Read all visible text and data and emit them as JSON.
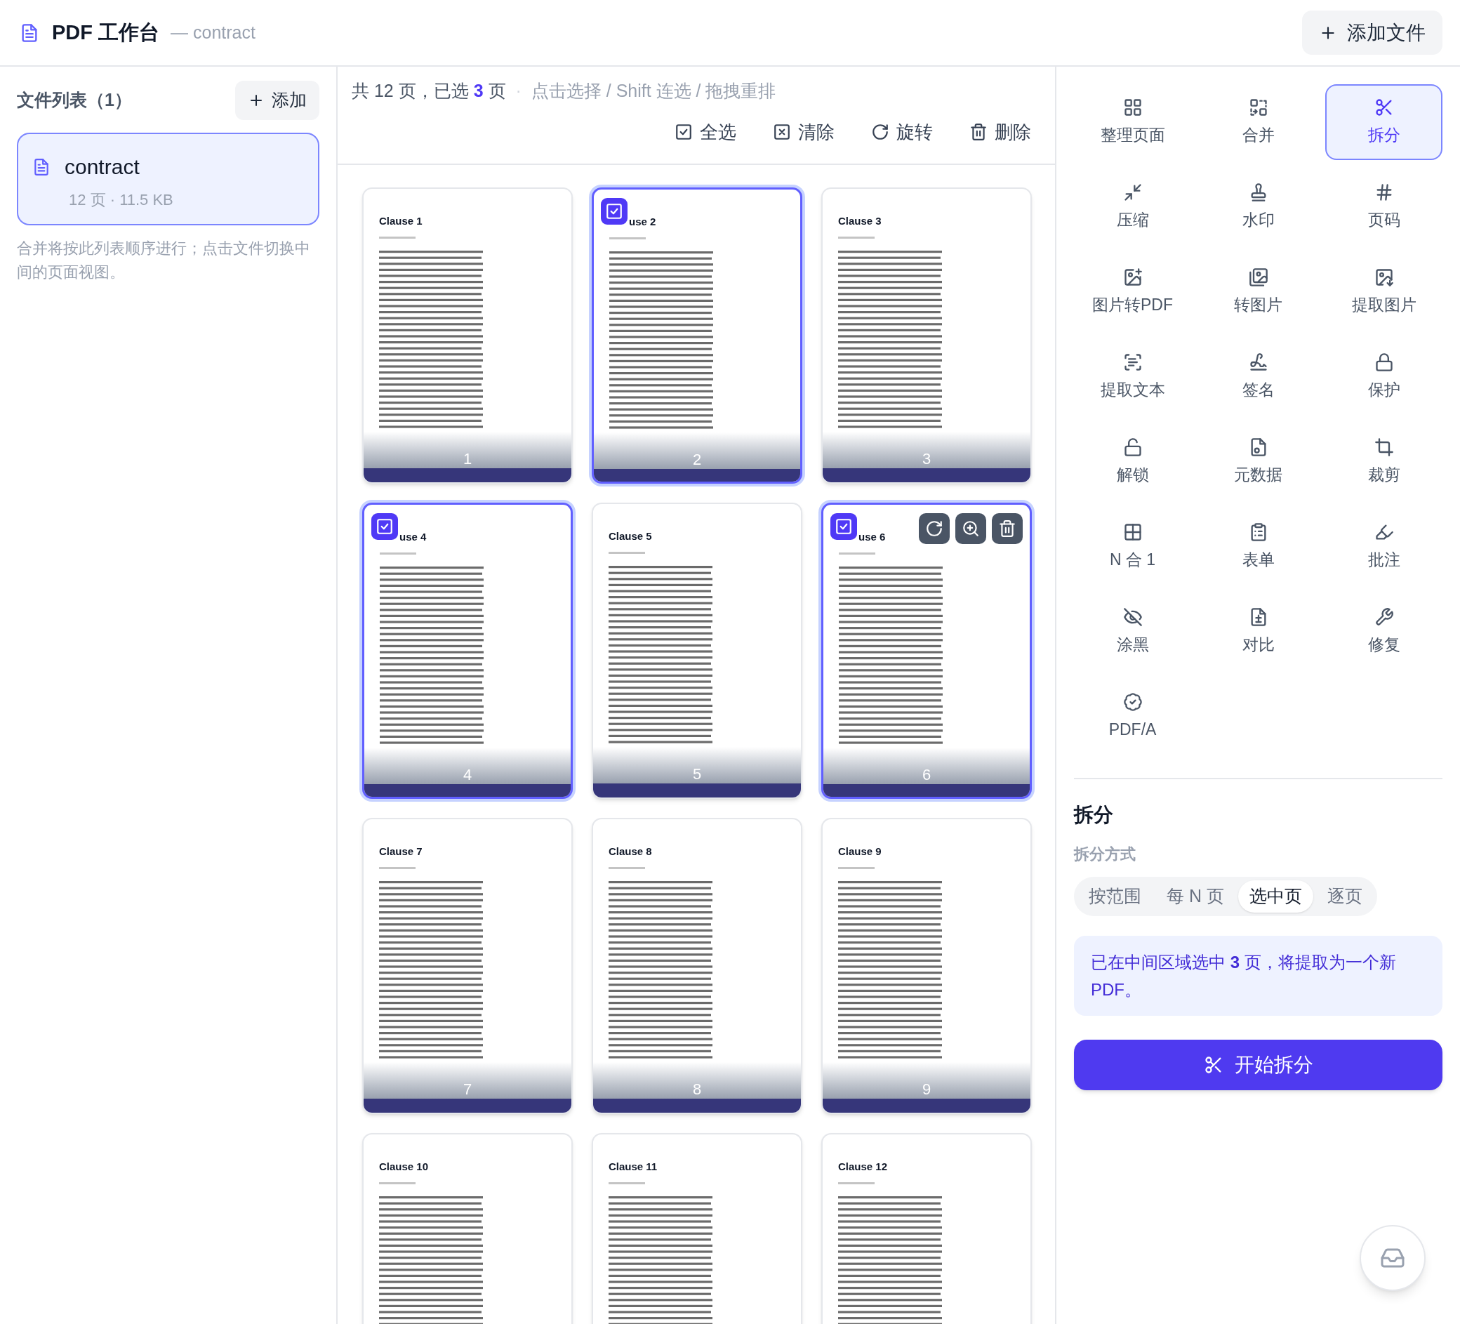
{
  "header": {
    "title": "PDF 工作台",
    "subtitle": "— contract",
    "add_button": "添加文件"
  },
  "sidebar": {
    "heading": "文件列表（1）",
    "add_button": "添加",
    "files": [
      {
        "name": "contract",
        "meta": "12 页 · 11.5 KB",
        "selected": true
      }
    ],
    "note": "合并将按此列表顺序进行；点击文件切换中间的页面视图。"
  },
  "workspace": {
    "summary": "共 12 页，已选 **3** 页",
    "separator": "·",
    "hint": "点击选择 / Shift 连选 / 拖拽重排",
    "actions": [
      {
        "label": "全选"
      },
      {
        "label": "清除"
      },
      {
        "label": "旋转"
      },
      {
        "label": "删除"
      }
    ],
    "pages": [
      {
        "number": "1",
        "title": "Clause 1",
        "selected": false,
        "show_actions": false
      },
      {
        "number": "2",
        "title": "use 2",
        "selected": true,
        "show_actions": false
      },
      {
        "number": "3",
        "title": "Clause 3",
        "selected": false,
        "show_actions": false
      },
      {
        "number": "4",
        "title": "use 4",
        "selected": true,
        "show_actions": false
      },
      {
        "number": "5",
        "title": "Clause 5",
        "selected": false,
        "show_actions": false
      },
      {
        "number": "6",
        "title": "use 6",
        "selected": true,
        "show_actions": true
      },
      {
        "number": "7",
        "title": "Clause 7",
        "selected": false,
        "show_actions": false
      },
      {
        "number": "8",
        "title": "Clause 8",
        "selected": false,
        "show_actions": false
      },
      {
        "number": "9",
        "title": "Clause 9",
        "selected": false,
        "show_actions": false
      },
      {
        "title": "Clause 10",
        "selected": false,
        "show_actions": false
      },
      {
        "title": "Clause 11",
        "selected": false,
        "show_actions": false
      },
      {
        "title": "Clause 12",
        "selected": false,
        "show_actions": false
      }
    ]
  },
  "tools": [
    {
      "label": "整理页面",
      "selected": false
    },
    {
      "label": "合并",
      "selected": false
    },
    {
      "label": "拆分",
      "selected": true
    },
    {
      "label": "压缩",
      "selected": false
    },
    {
      "label": "水印",
      "selected": false
    },
    {
      "label": "页码",
      "selected": false
    },
    {
      "label": "图片转PDF",
      "selected": false
    },
    {
      "label": "转图片",
      "selected": false
    },
    {
      "label": "提取图片",
      "selected": false
    },
    {
      "label": "提取文本",
      "selected": false
    },
    {
      "label": "签名",
      "selected": false
    },
    {
      "label": "保护",
      "selected": false
    },
    {
      "label": "解锁",
      "selected": false
    },
    {
      "label": "元数据",
      "selected": false
    },
    {
      "label": "裁剪",
      "selected": false
    },
    {
      "label": "N 合 1",
      "selected": false
    },
    {
      "label": "表单",
      "selected": false
    },
    {
      "label": "批注",
      "selected": false
    },
    {
      "label": "涂黑",
      "selected": false
    },
    {
      "label": "对比",
      "selected": false
    },
    {
      "label": "修复",
      "selected": false
    },
    {
      "label": "PDF/A",
      "selected": false
    }
  ],
  "split_panel": {
    "title": "拆分",
    "mode_label": "拆分方式",
    "modes": [
      {
        "label": "按范围",
        "selected": false
      },
      {
        "label": "每 N 页",
        "selected": false
      },
      {
        "label": "选中页",
        "selected": true
      },
      {
        "label": "逐页",
        "selected": false
      }
    ],
    "info": "已在中间区域选中 **3** 页，将提取为一个新PDF。",
    "start_button": "开始拆分"
  }
}
